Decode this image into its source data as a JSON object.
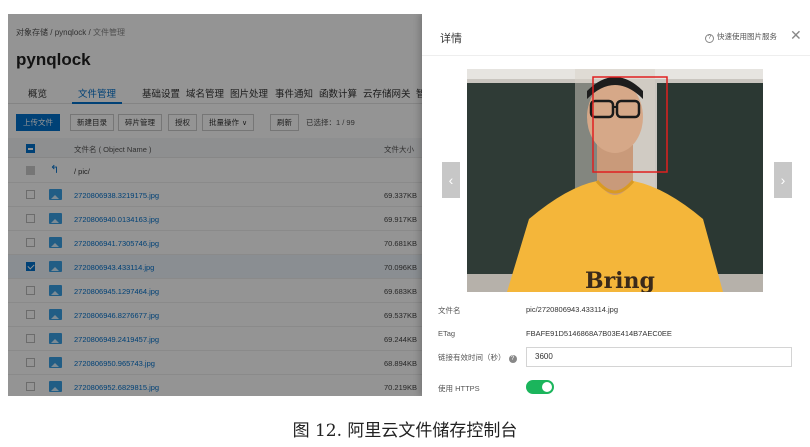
{
  "console": {
    "breadcrumb": {
      "root": "对象存储",
      "bucket": "pynqlock",
      "current": "文件管理"
    },
    "bucket_title": "pynqlock",
    "tabs": [
      "概览",
      "文件管理",
      "基础设置",
      "域名管理",
      "图片处理",
      "事件通知",
      "函数计算",
      "云存储网关",
      "智"
    ],
    "active_tab": "文件管理",
    "toolbar": {
      "upload": "上传文件",
      "new_dir": "新建目录",
      "fragments": "碎片管理",
      "auth": "授权",
      "batch": "批量操作",
      "refresh": "刷新",
      "selected": "已选择：1 / 99"
    },
    "columns": {
      "name": "文件名 ( Object Name )",
      "size": "文件大小"
    },
    "parent_path": "pic/",
    "files": [
      {
        "name": "2720806938.3219175.jpg",
        "size": "69.337KB",
        "selected": false
      },
      {
        "name": "2720806940.0134163.jpg",
        "size": "69.917KB",
        "selected": false
      },
      {
        "name": "2720806941.7305746.jpg",
        "size": "70.681KB",
        "selected": false
      },
      {
        "name": "2720806943.433114.jpg",
        "size": "70.096KB",
        "selected": true
      },
      {
        "name": "2720806945.1297464.jpg",
        "size": "69.683KB",
        "selected": false
      },
      {
        "name": "2720806946.8276677.jpg",
        "size": "69.537KB",
        "selected": false
      },
      {
        "name": "2720806949.2419457.jpg",
        "size": "69.244KB",
        "selected": false
      },
      {
        "name": "2720806950.965743.jpg",
        "size": "68.894KB",
        "selected": false
      },
      {
        "name": "2720806952.6829815.jpg",
        "size": "70.219KB",
        "selected": false
      }
    ]
  },
  "drawer": {
    "title": "详情",
    "quick_link": "快速使用图片服务",
    "fields": {
      "filename_label": "文件名",
      "filename_value": "pic/2720806943.433114.jpg",
      "etag_label": "ETag",
      "etag_value": "FBAFE91D5146868A7B03E414B7AEC0EE",
      "expiry_label": "链接有效时间（秒）",
      "expiry_value": "3600",
      "https_label": "使用 HTTPS",
      "https_on": true
    },
    "photo": {
      "shirt_text": "Bring"
    }
  },
  "caption": "图 12. 阿里云文件储存控制台",
  "colors": {
    "accent": "#0070cc",
    "toggle": "#1bb55c",
    "face_box": "#e02020",
    "shirt": "#f4b63a"
  }
}
